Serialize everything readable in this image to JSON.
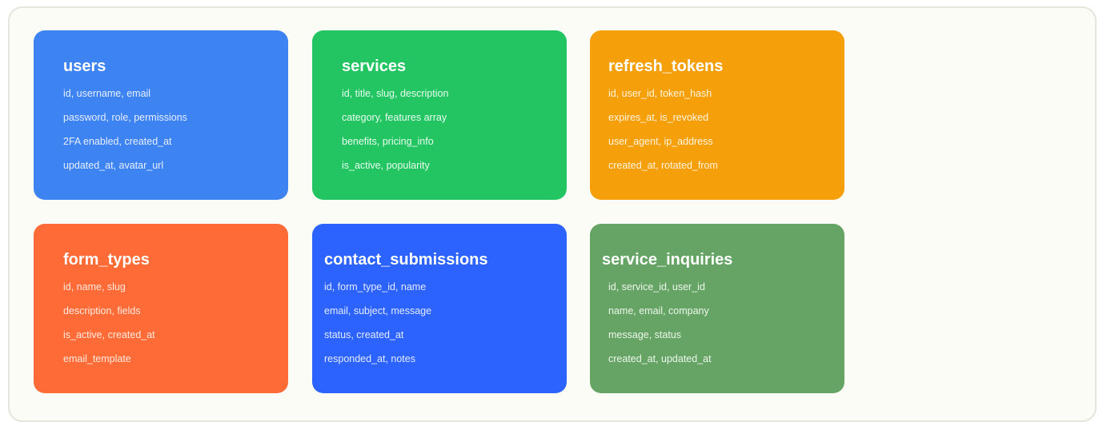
{
  "entities": [
    {
      "name": "users",
      "color": "#3e83f2",
      "text_color": "#e6efff",
      "fields": [
        "id, username, email",
        "password, role, permissions",
        "2FA enabled, created_at",
        "updated_at, avatar_url"
      ]
    },
    {
      "name": "services",
      "color": "#22c562",
      "text_color": "#e8fbef",
      "fields": [
        "id, title, slug, description",
        "category, features array",
        "benefits, pricing_info",
        "is_active, popularity"
      ]
    },
    {
      "name": "refresh_tokens",
      "color": "#f59f0b",
      "text_color": "#fff4dc",
      "fields": [
        "id, user_id, token_hash",
        "expires_at, is_revoked",
        "user_agent, ip_address",
        "created_at, rotated_from"
      ]
    },
    {
      "name": "form_types",
      "color": "#ff6b37",
      "text_color": "#ffe9df",
      "fields": [
        "id, name, slug",
        "description, fields",
        "is_active, created_at",
        "email_template"
      ]
    },
    {
      "name": "contact_submissions",
      "color": "#2c63fe",
      "text_color": "#e3ebff",
      "fields": [
        "id, form_type_id, name",
        "email, subject, message",
        "status, created_at",
        "responded_at, notes"
      ]
    },
    {
      "name": "service_inquiries",
      "color": "#65a464",
      "text_color": "#eef6ec",
      "fields": [
        "id, service_id, user_id",
        "name, email, company",
        "message, status",
        "created_at, updated_at"
      ]
    }
  ]
}
